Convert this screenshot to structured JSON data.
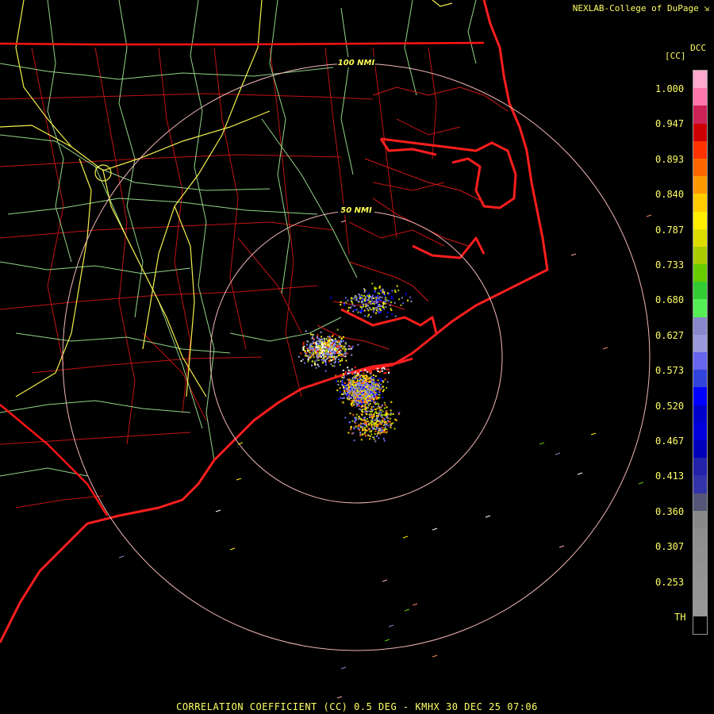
{
  "credit": "NEXLAB-College of DuPage",
  "footer": "CORRELATION COEFFICIENT (CC) 0.5 DEG - KMHX 30 DEC 25 07:06",
  "legend": {
    "product_code": "DCC",
    "unit": "[CC]",
    "labels": [
      "1.000",
      "0.947",
      "0.893",
      "0.840",
      "0.787",
      "0.733",
      "0.680",
      "0.627",
      "0.573",
      "0.520",
      "0.467",
      "0.413",
      "0.360",
      "0.307",
      "0.253",
      "TH"
    ],
    "colors": [
      "#ffaacc",
      "#ff77aa",
      "#cc2255",
      "#cc0000",
      "#ff3300",
      "#ff6600",
      "#ff9900",
      "#ffcc00",
      "#ffee00",
      "#dddd00",
      "#aacc00",
      "#66cc00",
      "#33cc33",
      "#55ee55",
      "#8888cc",
      "#9999dd",
      "#6666ee",
      "#3344dd",
      "#0000ff",
      "#0000cc",
      "#0000dd",
      "#0000bb",
      "#2222aa",
      "#3333aa",
      "#555577",
      "#888888",
      "#8e8e8e",
      "#909090",
      "#929292",
      "#959595",
      "#989898",
      "#000000"
    ]
  },
  "range_rings": [
    {
      "label": "50 NMI",
      "radius_nmi": 50
    },
    {
      "label": "100 NMI",
      "radius_nmi": 100
    }
  ],
  "colors": {
    "background": "#000000",
    "state_borders": "#ff1111",
    "county_lines": "#cc1111",
    "coastline": "#ff2222",
    "highways_major": "#ffff55",
    "highways_minor": "#99dd88",
    "range_ring": "#f2b7b7",
    "text": "#ffff66"
  }
}
